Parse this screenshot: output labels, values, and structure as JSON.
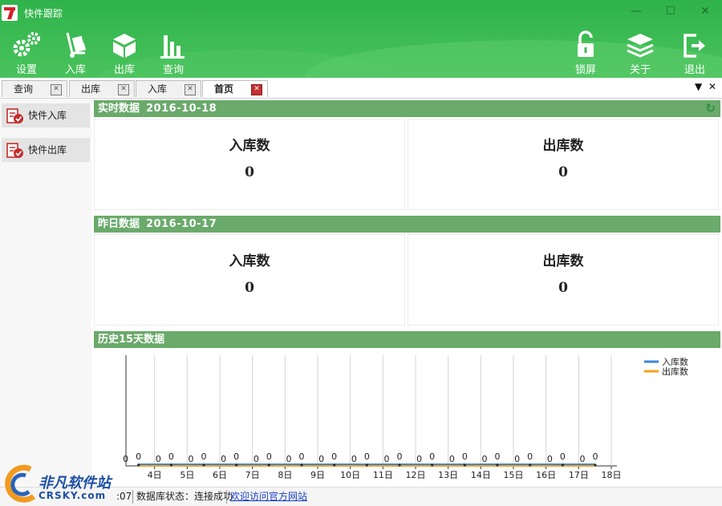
{
  "window": {
    "title": "快件跟踪",
    "controls": {
      "minimize": "—",
      "maximize": "☐",
      "close": "✕"
    }
  },
  "toolbar": {
    "left": [
      {
        "label": "设置",
        "icon": "gears-icon"
      },
      {
        "label": "入库",
        "icon": "hand-truck-icon"
      },
      {
        "label": "出库",
        "icon": "box-icon"
      },
      {
        "label": "查询",
        "icon": "bar-chart-icon"
      }
    ],
    "right": [
      {
        "label": "锁屏",
        "icon": "lock-icon"
      },
      {
        "label": "关于",
        "icon": "layers-icon"
      },
      {
        "label": "退出",
        "icon": "exit-icon"
      }
    ]
  },
  "tabs": [
    {
      "label": "查询",
      "active": false
    },
    {
      "label": "出库",
      "active": false
    },
    {
      "label": "入库",
      "active": false
    },
    {
      "label": "首页",
      "active": true
    }
  ],
  "tab_controls": {
    "dropdown": "▼",
    "close": "✕",
    "tab_close": "✕"
  },
  "sidebar": {
    "items": [
      {
        "label": "快件入库"
      },
      {
        "label": "快件出库"
      }
    ]
  },
  "realtime": {
    "title": "实时数据",
    "date": "2016-10-18",
    "refresh": "↻",
    "in_label": "入库数",
    "in_value": "0",
    "out_label": "出库数",
    "out_value": "0"
  },
  "yesterday": {
    "title": "昨日数据",
    "date": "2016-10-17",
    "in_label": "入库数",
    "in_value": "0",
    "out_label": "出库数",
    "out_value": "0"
  },
  "history": {
    "title": "历史15天数据"
  },
  "chart_data": {
    "type": "line",
    "title": "",
    "xlabel": "",
    "ylabel": "",
    "categories": [
      "4日",
      "5日",
      "6日",
      "7日",
      "8日",
      "9日",
      "10日",
      "11日",
      "12日",
      "13日",
      "14日",
      "15日",
      "16日",
      "17日",
      "18日"
    ],
    "series": [
      {
        "name": "入库数",
        "color": "#3b86d6",
        "values": [
          0,
          0,
          0,
          0,
          0,
          0,
          0,
          0,
          0,
          0,
          0,
          0,
          0,
          0,
          0
        ]
      },
      {
        "name": "出库数",
        "color": "#f5a21b",
        "values": [
          0,
          0,
          0,
          0,
          0,
          0,
          0,
          0,
          0,
          0,
          0,
          0,
          0,
          0,
          0
        ]
      }
    ],
    "grid": "vertical",
    "legend": "top-right"
  },
  "statusbar": {
    "time_fragment": ":07",
    "db_status": "数据库状态：连接成功",
    "link": "欢迎访问官方网站"
  },
  "watermark": {
    "title": "非凡软件站",
    "url": "CRSKY.com"
  },
  "colors": {
    "header_green": "#3ebc55",
    "section_green": "#6aaa6b",
    "series_in": "#3b86d6",
    "series_out": "#f5a21b"
  }
}
